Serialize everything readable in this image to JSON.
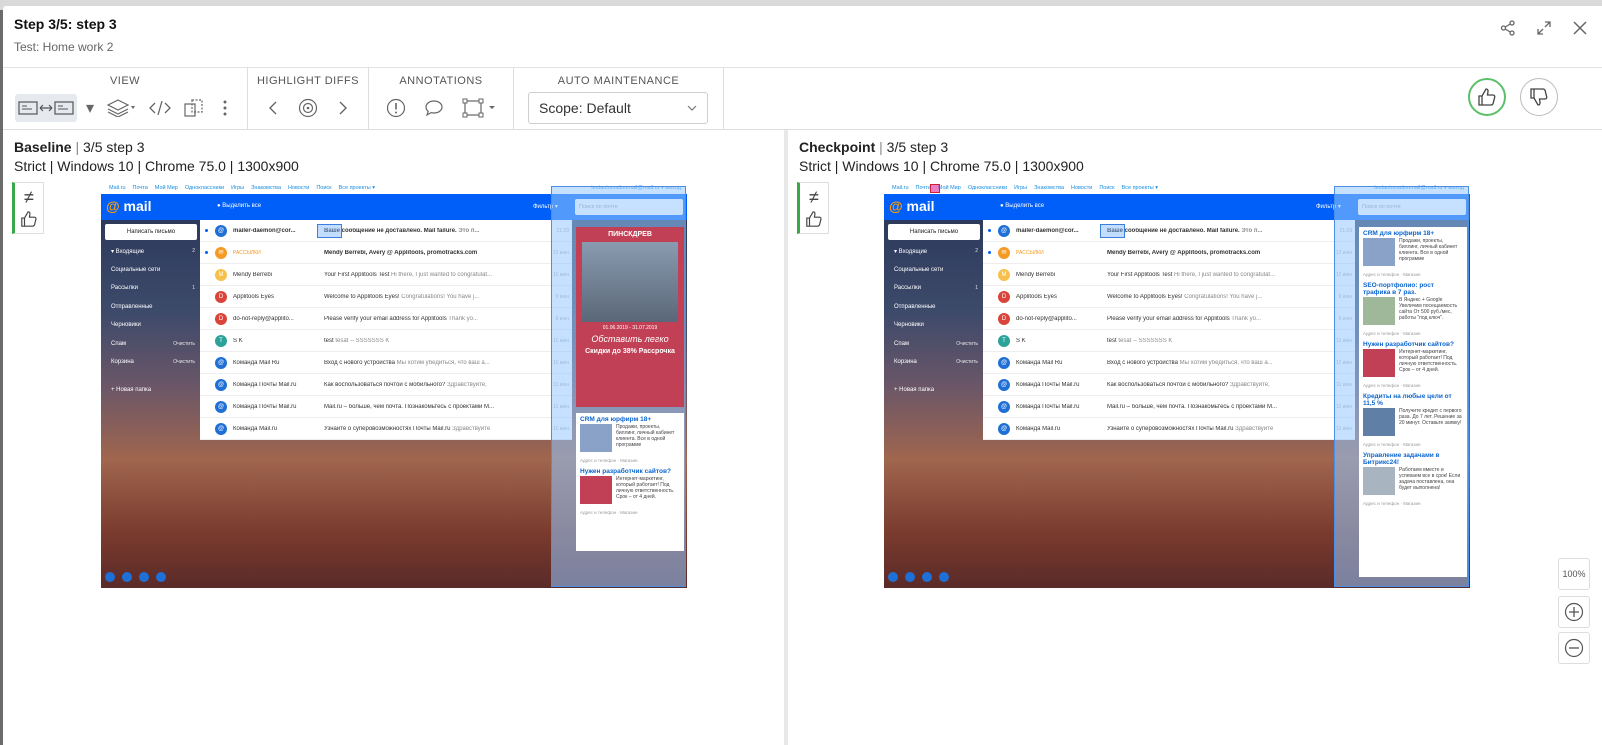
{
  "header": {
    "title": "Step 3/5: step 3",
    "subtitle": "Test: Home work 2",
    "icons": [
      "share-icon",
      "expand-icon",
      "close-icon"
    ]
  },
  "toolbar": {
    "view_label": "VIEW",
    "highlight_label": "HIGHLIGHT DIFFS",
    "annotations_label": "ANNOTATIONS",
    "auto_label": "AUTO MAINTENANCE",
    "scope_value": "Scope: Default"
  },
  "baseline": {
    "label": "Baseline",
    "step": "3/5 step 3",
    "meta": "Strict | Windows 10 | Chrome 75.0 | 1300x900",
    "status_symbol": "≠"
  },
  "checkpoint": {
    "label": "Checkpoint",
    "step": "3/5 step 3",
    "meta": "Strict | Windows 10 | Chrome 75.0 | 1300x900",
    "status_symbol": "≠"
  },
  "zoom": {
    "fit_label": "100%"
  },
  "mail": {
    "top_links": [
      "Mail.ru",
      "Почта",
      "Мой Мир",
      "Одноклассники",
      "Игры",
      "Знакомства",
      "Новости",
      "Поиск",
      "Все проекты ▾"
    ],
    "account": "testautomationmail@mail.ru ▾   выход",
    "logo": "mail",
    "select_all": "Выделить все",
    "filter": "Фильтр ▾",
    "search_placeholder": "Поиск по почте",
    "compose": "Написать письмо",
    "folders": [
      {
        "name": "▾ Входящие",
        "count": "2"
      },
      {
        "name": "Социальные сети",
        "count": ""
      },
      {
        "name": "Рассылки",
        "count": "1"
      },
      {
        "name": "Отправленные",
        "count": ""
      },
      {
        "name": "Черновики",
        "count": ""
      },
      {
        "name": "Спам",
        "count": "Очистить"
      },
      {
        "name": "Корзина",
        "count": "Очистить"
      },
      {
        "name": "+ Новая папка",
        "count": ""
      }
    ],
    "rows": [
      {
        "from": "mailer-daemon@cor...",
        "subject": "Ваше сообщение не доставлено. Mail failure.",
        "preview": " Это п...",
        "date": "21:29",
        "avatar": "@",
        "color": "#1e6fd6"
      },
      {
        "from": "РАССЫЛКИ",
        "subject": "Mendy Berrebi, Avery @ Applitools, promotracks.com",
        "preview": "",
        "date": "12 июн",
        "avatar": "✉",
        "color": "#f59a23"
      },
      {
        "from": "Mendy Berrebi",
        "subject": "Your First Applitools Test",
        "preview": " Hi there, I just wanted to congratulat...",
        "date": "11 июн",
        "avatar": "M",
        "color": "#f6c04a"
      },
      {
        "from": "Applitools Eyes",
        "subject": "Welcome to Applitools Eyes!",
        "preview": " Congratulations! You have j...",
        "date": "9 июн",
        "avatar": "D",
        "color": "#d9453b"
      },
      {
        "from": "do-not-reply@applito...",
        "subject": "Please verify your email address for Applitools",
        "preview": " Thank yo...",
        "date": "9 июн",
        "avatar": "D",
        "color": "#d9453b"
      },
      {
        "from": "S K",
        "subject": "test",
        "preview": " tesat -- SSSSSSS K",
        "date": "11 июн",
        "avatar": "T",
        "color": "#2ba39a"
      },
      {
        "from": "Команда Mail Ru",
        "subject": "Вход с нового устройства",
        "preview": " Мы хотим убедиться, что ваш а...",
        "date": "11 июн",
        "avatar": "@",
        "color": "#1e6fd6"
      },
      {
        "from": "Команда Почты Mail.ru",
        "subject": "Как воспользоваться почтой с мобильного?",
        "preview": " Здравствуйте,",
        "date": "11 июн",
        "avatar": "@",
        "color": "#1e6fd6"
      },
      {
        "from": "Команда Почты Mail.ru",
        "subject": "Mail.ru – больше, чем почта. Познакомьтесь с проектами М...",
        "preview": "",
        "date": "11 июн",
        "avatar": "@",
        "color": "#1e6fd6"
      },
      {
        "from": "Команда Mail.ru",
        "subject": "Узнайте о суперовозможностях Почты Mail.ru",
        "preview": " Здравствуйте",
        "date": "11 июн",
        "avatar": "@",
        "color": "#1e6fd6"
      }
    ],
    "baseline_ads": {
      "promo_brand": "ПИНСКДРЕВ",
      "promo_dates": "01.06.2019 - 31.07.2019",
      "promo_text": "Обставить легко",
      "promo_offer": "Скидки до 38% Рассрочка",
      "ad1_title": "CRM для юрфирм 18+",
      "ad1_text": "Продажи, проекты, биллинг, личный кабинет клиента. Все в одной программе",
      "ad2_title": "Нужен разработчик сайтов?",
      "ad2_text": "Интернет-маркетинг, который работает! Под личную ответственность. Срок – от 4 дней."
    },
    "checkpoint_ads": [
      {
        "title": "CRM для юрфирм 18+",
        "text": "Продажи, проекты, биллинг, личный кабинет клиента. Все в одной программе"
      },
      {
        "title": "SEO-портфолио: рост трафика в 7 раз.",
        "text": "В Яндекс + Google Увеличим посещаемость сайта От 500 руб./мес, работы \"под ключ\"."
      },
      {
        "title": "Нужен разработчик сайтов?",
        "text": "Интернет-маркетинг, который работает! Под личную ответственность. Срок – от 4 дней."
      },
      {
        "title": "Кредиты на любые цели от 11,5 %",
        "text": "Получите кредит с первого раза. До 7 лет. Решение за 20 минут. Оставьте заявку!"
      },
      {
        "title": "Управление задачами в Битрикс24!",
        "text": "Работаем вместе и успеваем все в срок! Если задача поставлена, она будет выполнена!"
      }
    ]
  }
}
